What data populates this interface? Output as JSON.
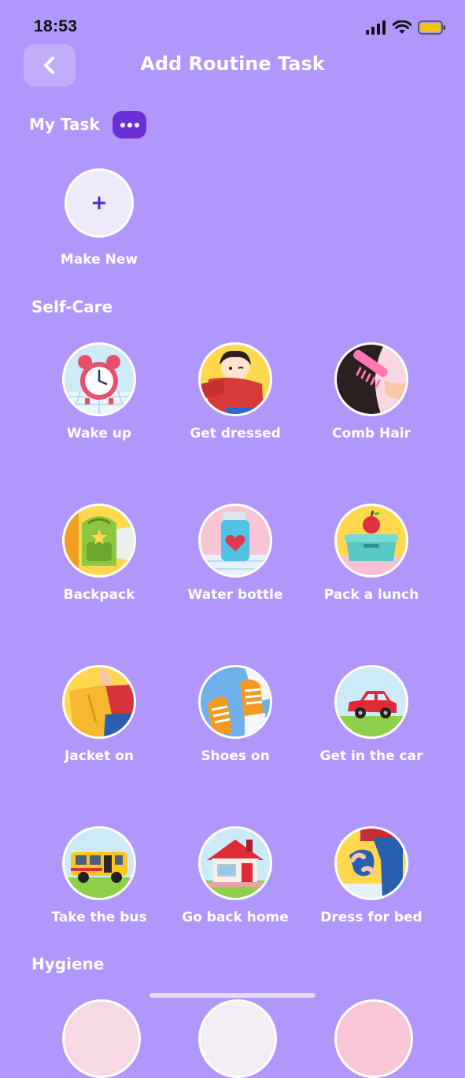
{
  "status_bar": {
    "time": "18:53",
    "icons": [
      "signal-icon",
      "wifi-icon",
      "battery-icon"
    ],
    "battery_color": "#f5c400"
  },
  "header": {
    "title": "Add Routine Task",
    "back_icon": "chevron-left-icon"
  },
  "my_task": {
    "heading": "My Task",
    "more_icon": "more-dots-icon",
    "make_new": {
      "icon": "plus-icon",
      "symbol": "+",
      "label": "Make New"
    }
  },
  "self_care": {
    "heading": "Self-Care",
    "tasks": [
      {
        "label": "Wake up",
        "icon": "alarm-clock-icon"
      },
      {
        "label": "Get dressed",
        "icon": "child-dressing-icon"
      },
      {
        "label": "Comb Hair",
        "icon": "comb-icon"
      },
      {
        "label": "Backpack",
        "icon": "backpack-icon"
      },
      {
        "label": "Water bottle",
        "icon": "water-bottle-icon"
      },
      {
        "label": "Pack a lunch",
        "icon": "lunchbox-icon"
      },
      {
        "label": "Jacket on",
        "icon": "jacket-icon"
      },
      {
        "label": "Shoes on",
        "icon": "shoes-icon"
      },
      {
        "label": "Get in the car",
        "icon": "car-icon"
      },
      {
        "label": "Take the bus",
        "icon": "bus-icon"
      },
      {
        "label": "Go back home",
        "icon": "house-icon"
      },
      {
        "label": "Dress for bed",
        "icon": "pajamas-icon"
      }
    ]
  },
  "hygiene": {
    "heading": "Hygiene"
  },
  "colors": {
    "background": "#b197fc",
    "accent": "#6b2fd6",
    "text": "#ffffff"
  }
}
